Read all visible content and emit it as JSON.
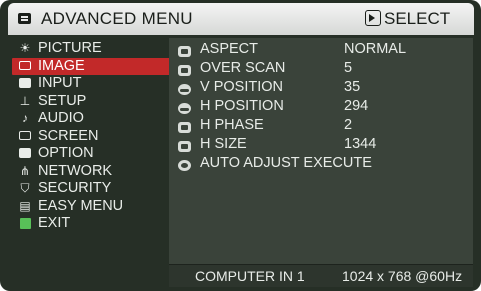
{
  "header": {
    "title": "ADVANCED MENU",
    "select_label": "SELECT"
  },
  "left_menu": {
    "items": [
      {
        "label": "PICTURE",
        "icon": "picture-icon"
      },
      {
        "label": "IMAGE",
        "icon": "image-icon",
        "active": true
      },
      {
        "label": "INPUT",
        "icon": "input-icon"
      },
      {
        "label": "SETUP",
        "icon": "setup-icon"
      },
      {
        "label": "AUDIO",
        "icon": "audio-icon"
      },
      {
        "label": "SCREEN",
        "icon": "screen-icon"
      },
      {
        "label": "OPTION",
        "icon": "option-icon"
      },
      {
        "label": "NETWORK",
        "icon": "network-icon"
      },
      {
        "label": "SECURITY",
        "icon": "security-icon"
      },
      {
        "label": "EASY MENU",
        "icon": "easy-menu-icon"
      },
      {
        "label": "EXIT",
        "icon": "exit-icon"
      }
    ]
  },
  "image_menu": {
    "items": [
      {
        "label": "ASPECT",
        "value": "NORMAL",
        "icon": "aspect-icon"
      },
      {
        "label": "OVER SCAN",
        "value": "5",
        "icon": "over-scan-icon"
      },
      {
        "label": "V POSITION",
        "value": "35",
        "icon": "v-position-icon"
      },
      {
        "label": "H POSITION",
        "value": "294",
        "icon": "h-position-icon"
      },
      {
        "label": "H PHASE",
        "value": "2",
        "icon": "h-phase-icon"
      },
      {
        "label": "H SIZE",
        "value": "1344",
        "icon": "h-size-icon"
      },
      {
        "label": "AUTO ADJUST EXECUTE",
        "value": "",
        "icon": "auto-adjust-icon"
      }
    ]
  },
  "status": {
    "source": "COMPUTER IN 1",
    "signal": "1024 x 768 @60Hz"
  },
  "colors": {
    "accent": "#c22929",
    "background": "#262f26",
    "panel": "#3a433a",
    "header": "#e4e6e4"
  }
}
